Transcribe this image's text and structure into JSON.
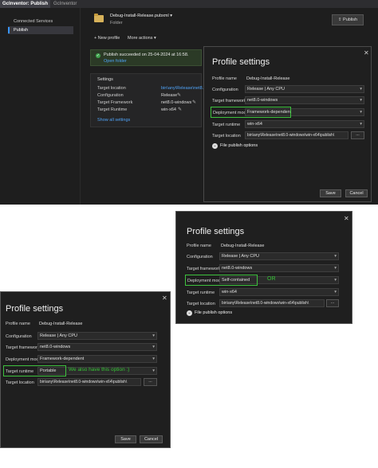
{
  "tabs": [
    {
      "label": "GcInventor: Publish"
    },
    {
      "label": "GcInventor"
    }
  ],
  "sidebar": {
    "items": [
      {
        "label": "Connected Services"
      },
      {
        "label": "Publish"
      }
    ]
  },
  "header": {
    "profile_file": "Debug-Install-Release.pubxml",
    "profile_kind": "Folder",
    "publish_label": "Publish"
  },
  "actions": {
    "new_profile": "New profile",
    "more_actions": "More actions"
  },
  "success": {
    "message": "Publish succeeded on 25-04-2024 at 16:58.",
    "open_folder": "Open folder"
  },
  "settings": {
    "heading": "Settings",
    "rows": [
      {
        "label": "Target location",
        "value": "bin\\any\\Release\\net8.0-win"
      },
      {
        "label": "Configuration",
        "value": "Release"
      },
      {
        "label": "Target Framework",
        "value": "net8.0-windows"
      },
      {
        "label": "Target Runtime",
        "value": "win-x64"
      }
    ],
    "show_all": "Show all settings"
  },
  "dialog1": {
    "title": "Profile settings",
    "profile_name_label": "Profile name",
    "profile_name": "Debug-Install-Release",
    "configuration_label": "Configuration",
    "configuration": "Release | Any CPU",
    "framework_label": "Target framework",
    "framework": "net8.0-windows",
    "deployment_label": "Deployment mode",
    "deployment": "Framework-dependent",
    "runtime_label": "Target runtime",
    "runtime": "win-x64",
    "location_label": "Target location",
    "location": "bin\\any\\Release\\net8.0-windows\\win-x64\\publish\\",
    "browse": "...",
    "file_options": "File publish options",
    "save": "Save",
    "cancel": "Cancel"
  },
  "dialog2": {
    "title": "Profile settings",
    "profile_name_label": "Profile name",
    "profile_name": "Debug-Install-Release",
    "configuration_label": "Configuration",
    "configuration": "Release | Any CPU",
    "framework_label": "Target framework",
    "framework": "net8.0-windows",
    "deployment_label": "Deployment mode",
    "deployment": "Self-contained",
    "note": "OR",
    "runtime_label": "Target runtime",
    "runtime": "win-x64",
    "location_label": "Target location",
    "location": "bin\\any\\Release\\net8.0-windows\\win-x64\\publish\\",
    "browse": "...",
    "file_options": "File publish options"
  },
  "dialog3": {
    "title": "Profile settings",
    "profile_name_label": "Profile name",
    "profile_name": "Debug-Install-Release",
    "configuration_label": "Configuration",
    "configuration": "Release | Any CPU",
    "framework_label": "Target framework",
    "framework": "net8.0-windows",
    "deployment_label": "Deployment mode",
    "deployment": "Framework-dependent",
    "runtime_label": "Target runtime",
    "runtime": "Portable",
    "note": "We also have this option :)",
    "location_label": "Target location",
    "location": "bin\\any\\Release\\net8.0-windows\\win-x64\\publish\\",
    "browse": "...",
    "save": "Save",
    "cancel": "Cancel"
  },
  "colors": {
    "highlight": "#3ec13e",
    "accent": "#3794ff",
    "success_bg": "#2b3a26"
  }
}
